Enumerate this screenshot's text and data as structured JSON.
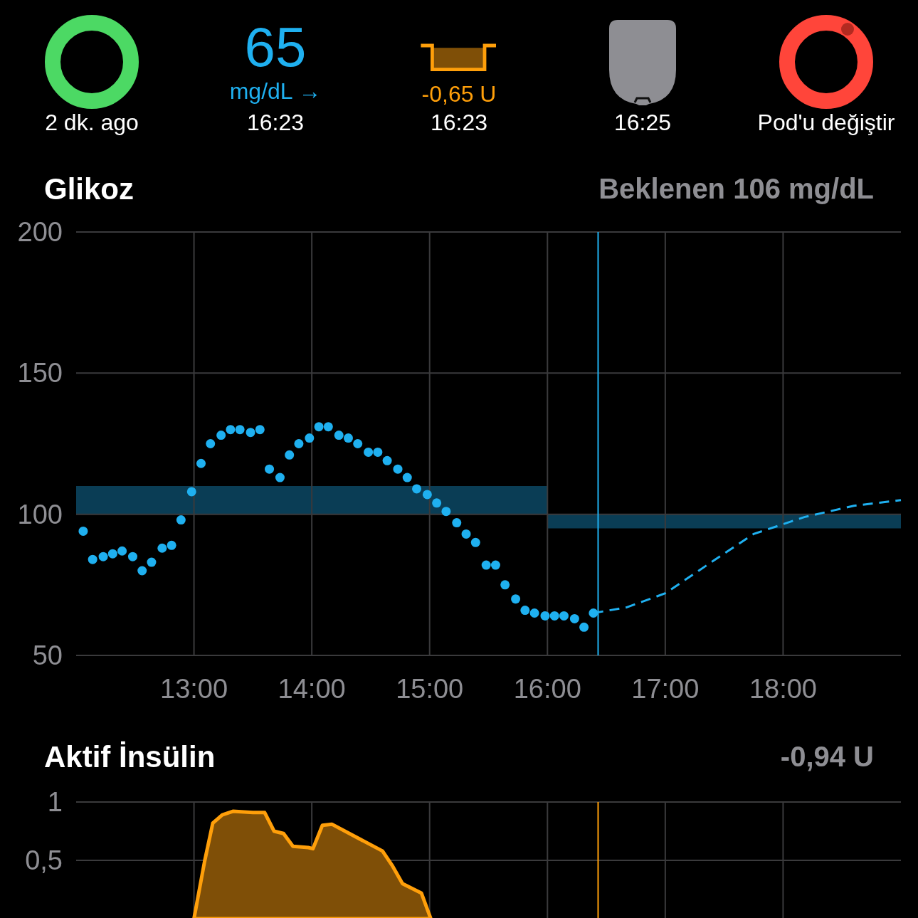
{
  "hud": {
    "loop": {
      "label": "2 dk. ago"
    },
    "glucose": {
      "value": "65",
      "unit": "mg/dL",
      "trend": "→",
      "time": "16:23"
    },
    "basal": {
      "rate": "-0,65 U",
      "time": "16:23"
    },
    "pod": {
      "time": "16:25"
    },
    "pod_life": {
      "label": "Pod'u değiştir"
    }
  },
  "glucose_section": {
    "title": "Glikoz",
    "summary": "Beklenen 106 mg/dL",
    "chart_data": {
      "type": "scatter",
      "grid": true,
      "xlim": [
        12,
        19
      ],
      "ylim": [
        50,
        200
      ],
      "xticks": [
        {
          "value": 13,
          "label": "13:00"
        },
        {
          "value": 14,
          "label": "14:00"
        },
        {
          "value": 15,
          "label": "15:00"
        },
        {
          "value": 16,
          "label": "16:00"
        },
        {
          "value": 17,
          "label": "17:00"
        },
        {
          "value": 18,
          "label": "18:00"
        }
      ],
      "yticks": [
        50,
        100,
        150,
        200
      ],
      "series": [
        {
          "color": "#1fb0f0",
          "x": [
            12.06,
            12.14,
            12.23,
            12.31,
            12.39,
            12.48,
            12.56,
            12.64,
            12.73,
            12.81,
            12.89,
            12.98,
            13.06,
            13.14,
            13.23,
            13.31,
            13.39,
            13.48,
            13.56,
            13.64,
            13.73,
            13.81,
            13.89,
            13.98,
            14.06,
            14.14,
            14.23,
            14.31,
            14.39,
            14.48,
            14.56,
            14.64,
            14.73,
            14.81,
            14.89,
            14.98,
            15.06,
            15.14,
            15.23,
            15.31,
            15.39,
            15.48,
            15.56,
            15.64,
            15.73,
            15.81,
            15.89,
            15.98,
            16.06,
            16.14,
            16.23,
            16.31,
            16.39
          ],
          "values": [
            94,
            84,
            85,
            86,
            87,
            85,
            80,
            83,
            88,
            89,
            98,
            108,
            118,
            125,
            128,
            130,
            130,
            129,
            130,
            116,
            113,
            121,
            125,
            127,
            131,
            131,
            128,
            127,
            125,
            122,
            122,
            119,
            116,
            113,
            109,
            107,
            104,
            101,
            97,
            93,
            90,
            82,
            82,
            75,
            70,
            66,
            65,
            64,
            64,
            64,
            63,
            60,
            65
          ]
        },
        {
          "type": "area",
          "color": "#0a3d55",
          "x": [
            12,
            16,
            16,
            19,
            19,
            16,
            16,
            12
          ],
          "values": [
            110,
            110,
            100,
            100,
            95,
            95,
            100,
            100
          ]
        },
        {
          "type": "line",
          "line_style": "dashed",
          "color": "#1fb0f0",
          "x": [
            16.39,
            16.67,
            17.0,
            17.39,
            17.75,
            18.18,
            18.6,
            19.0
          ],
          "values": [
            65,
            67,
            72,
            83,
            93,
            99,
            103,
            105
          ]
        }
      ],
      "ref_lines": [
        {
          "axis": "x",
          "value": 16.43
        }
      ]
    }
  },
  "insulin_section": {
    "title": "Aktif İnsülin",
    "summary": "-0,94 U",
    "chart_data": {
      "type": "area",
      "grid": true,
      "xlim": [
        12,
        19
      ],
      "ylim": [
        0,
        1
      ],
      "yticks": [
        {
          "value": 0.5,
          "label": "0,5"
        },
        {
          "value": 1,
          "label": "1"
        }
      ],
      "series": [
        {
          "color": "#ff9f0a",
          "x": [
            13.0,
            13.09,
            13.16,
            13.24,
            13.33,
            13.5,
            13.6,
            13.68,
            13.76,
            13.84,
            13.97,
            14.01,
            14.09,
            14.17,
            14.6,
            14.68,
            14.77,
            14.93,
            15.01
          ],
          "values": [
            0,
            0.49,
            0.82,
            0.89,
            0.92,
            0.91,
            0.91,
            0.75,
            0.73,
            0.62,
            0.61,
            0.6,
            0.8,
            0.81,
            0.58,
            0.46,
            0.3,
            0.22,
            0
          ]
        }
      ],
      "ref_lines": [
        {
          "axis": "x",
          "value": 16.43
        }
      ]
    }
  }
}
